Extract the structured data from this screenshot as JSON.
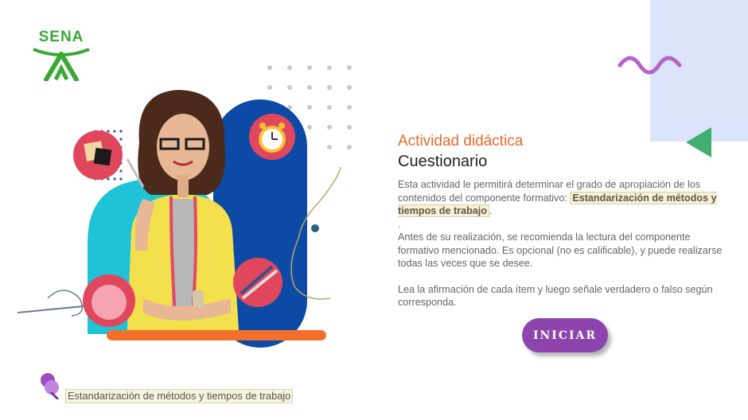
{
  "logo": {
    "text": "SENA"
  },
  "activity": {
    "subtitle": "Actividad didáctica",
    "title": "Cuestionario",
    "intro_prefix": "Esta actividad le permitirá determinar el grado de apropiación de los contenidos del componente formativo: ",
    "component_name": "Estandarización de métodos y tiempos de trabajo",
    "intro_suffix": ".",
    "separator": ".",
    "recommendation": "Antes de su realización, se recomienda la lectura del componente formativo mencionado.  Es opcional (no es calificable), y puede realizarse todas las veces que se desee.",
    "instruction": "Lea la afirmación de cada ítem y luego señale verdadero o falso según corresponda."
  },
  "start_button": {
    "label": "INICIAR"
  },
  "footer": {
    "label": "Estandarización de métodos y tiempos de trabajo"
  },
  "colors": {
    "accent": "#e8692a",
    "button": "#8e44ad",
    "brand_green": "#39a935",
    "deco_blue": "#dce4fb"
  },
  "icons": [
    "sena-logo",
    "wave-icon",
    "triangle-icon",
    "pin-icon"
  ]
}
